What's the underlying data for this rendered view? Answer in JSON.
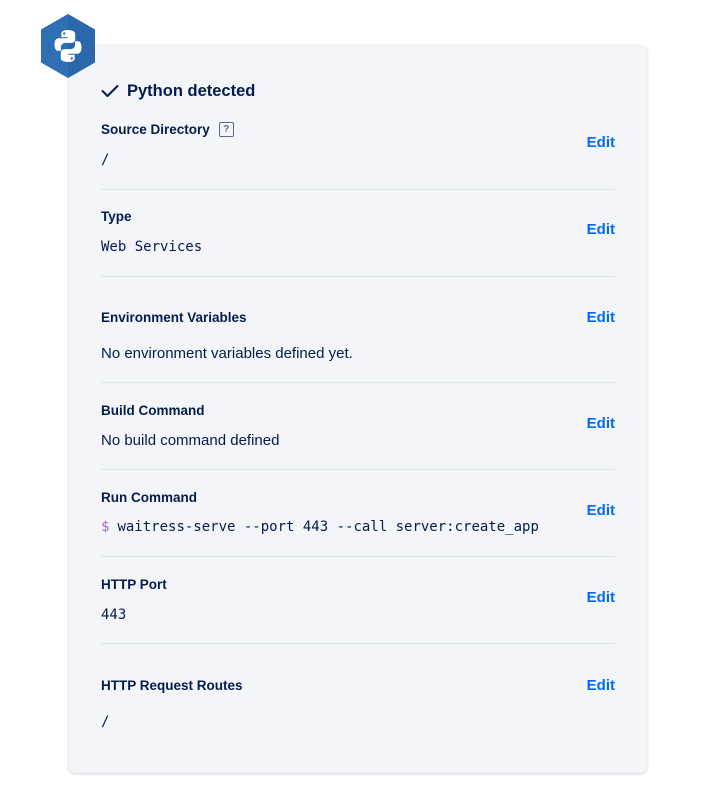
{
  "detection": {
    "label": "Python detected",
    "check_icon": "check-icon",
    "badge_icon": "python-icon"
  },
  "fields": {
    "source_directory": {
      "label": "Source Directory",
      "help": "?",
      "value": "/",
      "edit": "Edit"
    },
    "type": {
      "label": "Type",
      "value": "Web Services",
      "edit": "Edit"
    },
    "environment_variables": {
      "label": "Environment Variables",
      "value": "No environment variables defined yet.",
      "edit": "Edit"
    },
    "build_command": {
      "label": "Build Command",
      "value": "No build command defined",
      "edit": "Edit"
    },
    "run_command": {
      "label": "Run Command",
      "prompt": "$",
      "value": "waitress-serve --port 443 --call server:create_app",
      "edit": "Edit"
    },
    "http_port": {
      "label": "HTTP Port",
      "value": "443",
      "edit": "Edit"
    },
    "http_request_routes": {
      "label": "HTTP Request Routes",
      "value": "/",
      "edit": "Edit"
    }
  },
  "colors": {
    "accent": "#0069ff",
    "text": "#031b4e",
    "badge": "#2e6fb5",
    "prompt": "#9a6bd6"
  }
}
